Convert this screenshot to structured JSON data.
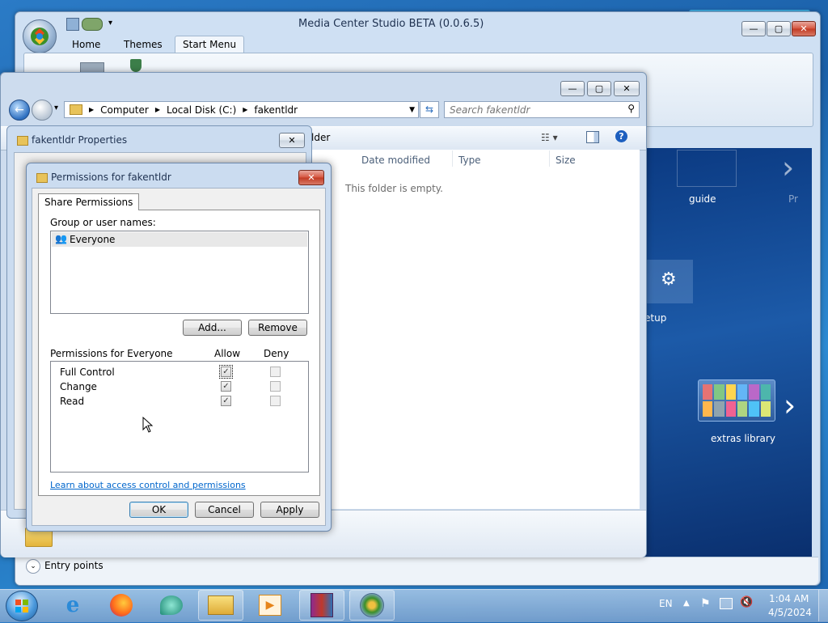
{
  "mcs_window": {
    "title": "Media Center Studio BETA (0.0.6.5)",
    "tabs": [
      "Home",
      "Themes",
      "Start Menu"
    ],
    "active_tab": "Start Menu",
    "bottom_label": "Entry points",
    "tiles": [
      "guide",
      "Pr",
      "etup",
      "extras library"
    ]
  },
  "explorer": {
    "breadcrumb": [
      "Computer",
      "Local Disk (C:)",
      "fakentldr"
    ],
    "search_placeholder": "Search fakentldr",
    "toolbar_fragment": "lder",
    "columns": [
      "Date modified",
      "Type",
      "Size"
    ],
    "empty_message": "This folder is empty."
  },
  "properties_dialog": {
    "title": "fakentldr Properties"
  },
  "permissions_dialog": {
    "title": "Permissions for fakentldr",
    "tab": "Share Permissions",
    "group_label": "Group or user names:",
    "users": [
      "Everyone"
    ],
    "add_button": "Add...",
    "remove_button": "Remove",
    "perm_label": "Permissions for Everyone",
    "allow_header": "Allow",
    "deny_header": "Deny",
    "permissions": [
      {
        "name": "Full Control",
        "allow": true,
        "deny": false
      },
      {
        "name": "Change",
        "allow": true,
        "deny": false
      },
      {
        "name": "Read",
        "allow": true,
        "deny": false
      }
    ],
    "help_link": "Learn about access control and permissions",
    "ok_button": "OK",
    "cancel_button": "Cancel",
    "apply_button": "Apply"
  },
  "taskbar": {
    "language": "EN",
    "time": "1:04 AM",
    "date": "4/5/2024"
  },
  "colors": {
    "link": "#0066cc",
    "selection": "#e8e8e8",
    "desktop": "#1a5fa8"
  }
}
